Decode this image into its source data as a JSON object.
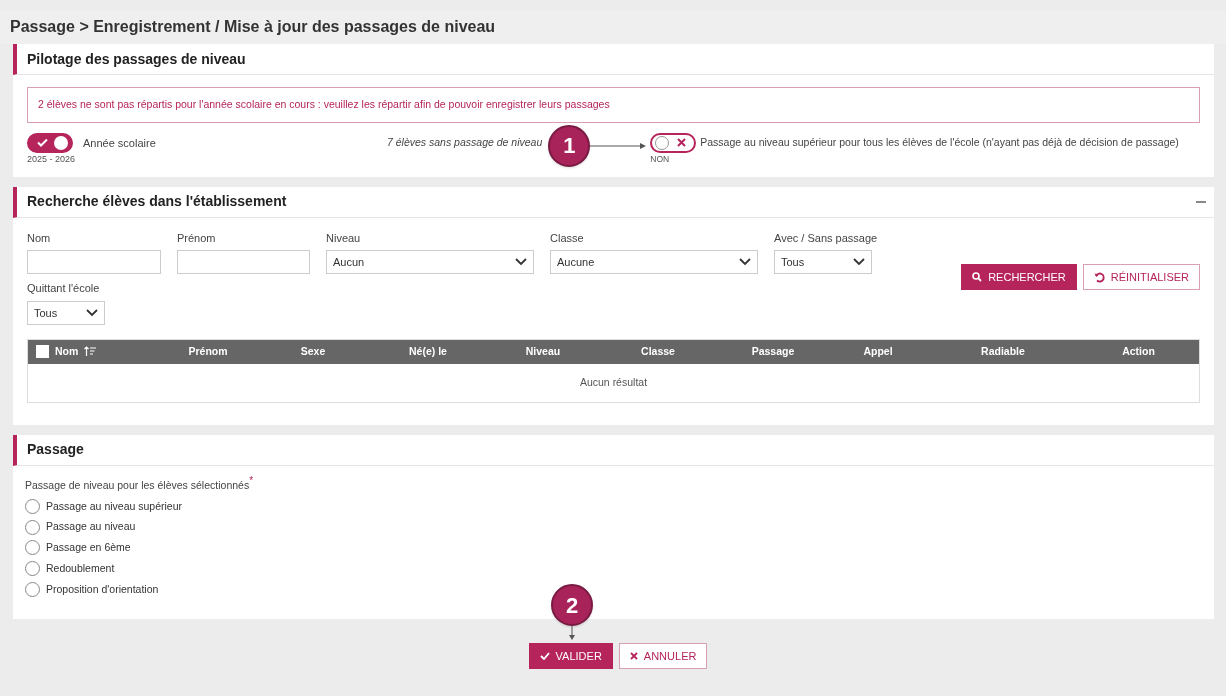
{
  "title": "Passage > Enregistrement / Mise à jour des passages de niveau",
  "pilotage": {
    "heading": "Pilotage des passages de niveau",
    "alert": "2 élèves ne sont pas répartis pour l'année scolaire en cours : veuillez les répartir afin de pouvoir enregistrer leurs passages",
    "year_toggle": {
      "on": true,
      "label": "Année scolaire",
      "value": "2025 - 2026"
    },
    "count_text": "7 élèves sans passage de niveau",
    "callout": "1",
    "all_toggle": {
      "on": false,
      "state_label": "NON",
      "label": "Passage au niveau supérieur pour tous les élèves de l'école (n'ayant pas déjà de décision de passage)"
    }
  },
  "search": {
    "heading": "Recherche élèves dans l'établissement",
    "fields": [
      {
        "kind": "text",
        "label": "Nom"
      },
      {
        "kind": "text",
        "label": "Prénom"
      },
      {
        "kind": "select",
        "label": "Niveau",
        "value": "Aucun"
      },
      {
        "kind": "select",
        "label": "Classe",
        "value": "Aucune"
      },
      {
        "kind": "select",
        "label": "Avec / Sans passage",
        "value": "Tous"
      },
      {
        "kind": "select",
        "label": "Quittant l'école",
        "value": "Tous"
      }
    ],
    "buttons": [
      {
        "kind": "primary",
        "label": "RECHERCHER"
      },
      {
        "kind": "outline",
        "label": "RÉINITIALISER"
      }
    ],
    "table": {
      "select_all_checked": false,
      "columns": [
        "Nom",
        "Prénom",
        "Sexe",
        "Né(e) le",
        "Niveau",
        "Classe",
        "Passage",
        "Appel",
        "Radiable",
        "Action"
      ],
      "empty": "Aucun résultat"
    }
  },
  "passage": {
    "heading": "Passage",
    "question": "Passage de niveau pour les élèves sélectionnés",
    "required": "*",
    "options": [
      {
        "label": "Passage au niveau supérieur",
        "selected": false
      },
      {
        "label": "Passage au niveau",
        "selected": false
      },
      {
        "label": "Passage en 6ème",
        "selected": false
      },
      {
        "label": "Redoublement",
        "selected": false
      },
      {
        "label": "Proposition d'orientation",
        "selected": false
      }
    ]
  },
  "callout2": "2",
  "footer": [
    {
      "kind": "primary",
      "label": "VALIDER"
    },
    {
      "kind": "outline",
      "label": "ANNULER"
    }
  ]
}
